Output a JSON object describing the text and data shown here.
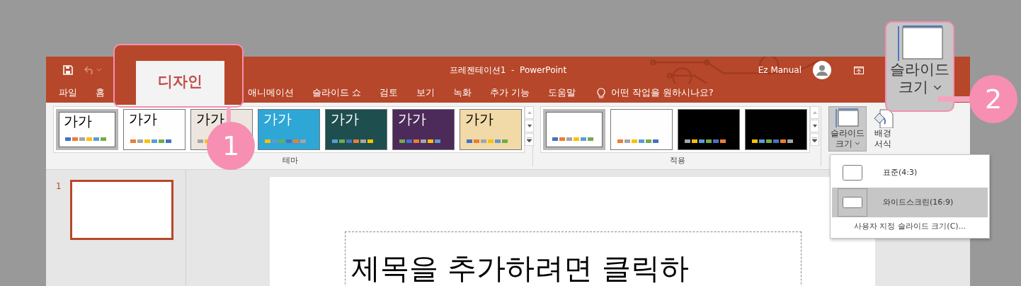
{
  "window": {
    "title": "프레젠테이션1  -  PowerPoint",
    "account": "Ez Manual"
  },
  "tabs": [
    {
      "label": "파일",
      "selected": false
    },
    {
      "label": "홈",
      "selected": false
    },
    {
      "label": "디자인",
      "selected": true
    },
    {
      "label": "애니메이션",
      "selected": false
    },
    {
      "label": "슬라이드 쇼",
      "selected": false
    },
    {
      "label": "검토",
      "selected": false
    },
    {
      "label": "보기",
      "selected": false
    },
    {
      "label": "녹화",
      "selected": false
    },
    {
      "label": "추가 기능",
      "selected": false
    },
    {
      "label": "도움말",
      "selected": false
    }
  ],
  "tell_me": {
    "label": "어떤 작업을 원하시나요?"
  },
  "themes": {
    "label": "테마",
    "items": [
      {
        "sample": "가가",
        "color": "#ffffff",
        "selected": true
      },
      {
        "sample": "가가",
        "color": "#fefefe",
        "selected": false
      },
      {
        "sample": "가가",
        "color": "#ece6df",
        "selected": false
      },
      {
        "sample": "가가",
        "color": "#2ea6d6",
        "selected": false
      },
      {
        "sample": "가가",
        "color": "#1f4e4f",
        "selected": false
      },
      {
        "sample": "가가",
        "color": "#4c2a5a",
        "selected": false
      },
      {
        "sample": "가가",
        "color": "#f2d9a8",
        "selected": false
      }
    ]
  },
  "variants": {
    "label": "적용",
    "items": [
      {
        "color": "#ffffff",
        "selected": true
      },
      {
        "color": "#fefefe",
        "selected": false
      },
      {
        "color": "#000000",
        "selected": false
      },
      {
        "color": "#010101",
        "selected": false
      }
    ]
  },
  "customize": {
    "buttons": [
      {
        "kind": "slide-size",
        "lines": [
          "슬라이드",
          "크기"
        ],
        "selected": true
      },
      {
        "kind": "format-background",
        "lines": [
          "배경",
          "서식"
        ],
        "selected": false
      }
    ]
  },
  "slide_size_menu": {
    "items": [
      {
        "kind": "standard",
        "label": "표준(4:3)",
        "selected": false
      },
      {
        "kind": "widescreen",
        "label": "와이드스크린(16:9)",
        "selected": true
      }
    ],
    "footer": "사용자 지정 슬라이드 크기(C)..."
  },
  "slides": [
    {
      "number": "1",
      "selected": true
    }
  ],
  "slide": {
    "title_placeholder": "제목을 추가하려면 클릭하"
  },
  "callouts": [
    {
      "kind": "tab",
      "number": "1"
    },
    {
      "kind": "button",
      "number": "2",
      "lines": [
        "슬라이드",
        "크기"
      ]
    }
  ]
}
